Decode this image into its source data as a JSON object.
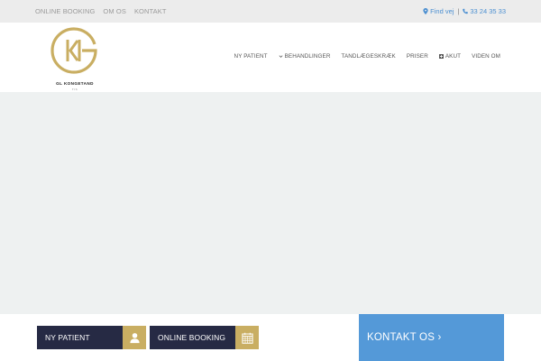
{
  "topbar": {
    "links": [
      "ONLINE BOOKING",
      "OM OS",
      "KONTAKT"
    ],
    "find_label": "Find vej",
    "separator": "|",
    "phone": "33 24 35 33"
  },
  "logo": {
    "brand": "GL KONGETAND",
    "sub": "TIS"
  },
  "nav": {
    "items": [
      "NY PATIENT",
      "BEHANDLINGER",
      "TANDLÆGESKRÆK",
      "PRISER",
      "AKUT",
      "VIDEN OM"
    ]
  },
  "cta": {
    "ny_patient": "NY PATIENT",
    "online_booking": "ONLINE BOOKING",
    "kontakt": "KONTAKT OS ›"
  },
  "colors": {
    "accent_gold": "#c9ae62",
    "navy": "#262a44",
    "blue": "#5499d8",
    "link_blue": "#4b8fd1"
  }
}
